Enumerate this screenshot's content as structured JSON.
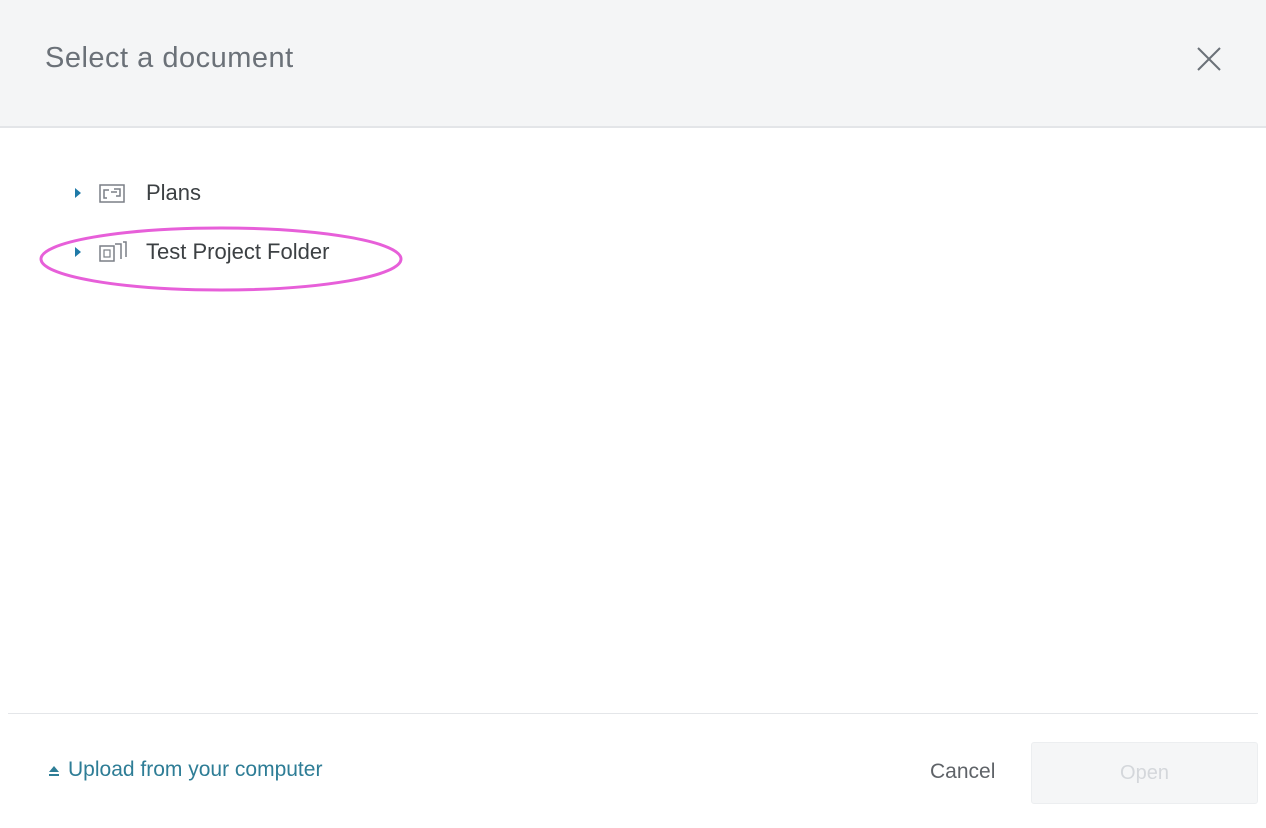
{
  "dialog": {
    "title": "Select a document"
  },
  "tree": {
    "items": [
      {
        "label": "Plans",
        "icon": "plans-icon",
        "expanded": false
      },
      {
        "label": "Test Project Folder",
        "icon": "project-folder-icon",
        "expanded": false,
        "highlighted": true
      }
    ]
  },
  "footer": {
    "upload_label": "Upload from your computer",
    "cancel_label": "Cancel",
    "open_label": "Open",
    "open_enabled": false
  },
  "colors": {
    "header_bg": "#f4f5f6",
    "link": "#2e7d96",
    "caret": "#1f7aa8",
    "highlight_ring": "#e75fd9",
    "open_disabled_text": "#d4d7db"
  }
}
